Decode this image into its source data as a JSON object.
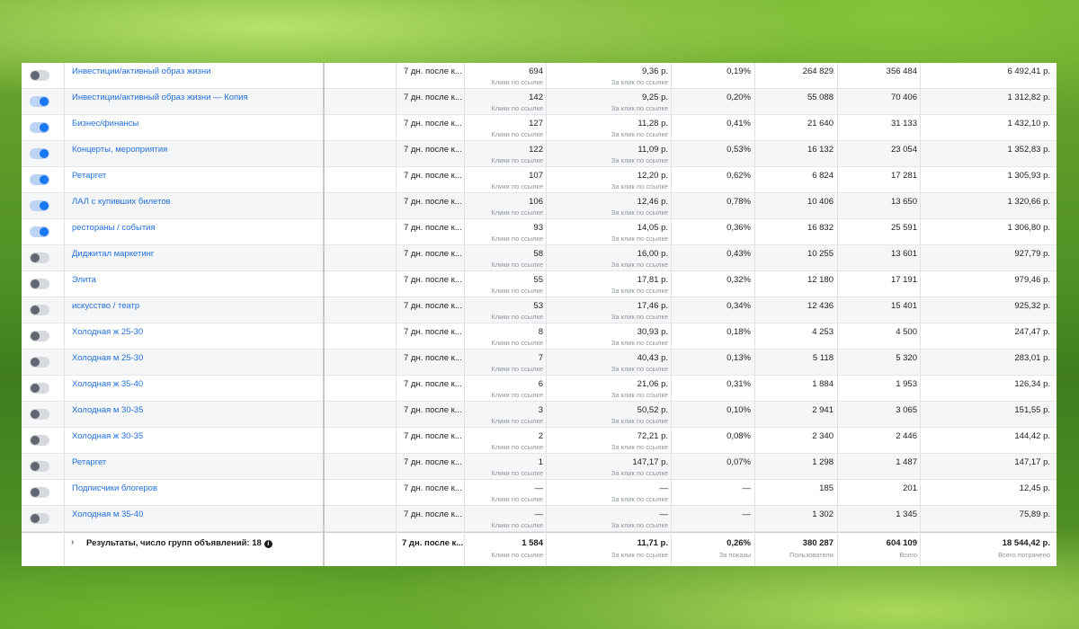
{
  "rows": [
    {
      "on": false,
      "name": "Инвестиции/активный образ жизни",
      "window": "7 дн. после к...",
      "results": "694",
      "results_sub": "Клики по ссылке",
      "cost": "9,36 р.",
      "cost_sub": "За клик по ссылке",
      "ctr": "0,19%",
      "reach": "264 829",
      "impressions": "356 484",
      "spent": "6 492,41 р."
    },
    {
      "on": true,
      "name": "Инвестиции/активный образ жизни — Копия",
      "window": "7 дн. после к...",
      "results": "142",
      "results_sub": "Клики по ссылке",
      "cost": "9,25 р.",
      "cost_sub": "За клик по ссылке",
      "ctr": "0,20%",
      "reach": "55 088",
      "impressions": "70 406",
      "spent": "1 312,82 р."
    },
    {
      "on": true,
      "name": "Бизнес/финансы",
      "window": "7 дн. после к...",
      "results": "127",
      "results_sub": "Клики по ссылке",
      "cost": "11,28 р.",
      "cost_sub": "За клик по ссылке",
      "ctr": "0,41%",
      "reach": "21 640",
      "impressions": "31 133",
      "spent": "1 432,10 р."
    },
    {
      "on": true,
      "name": "Концерты, мероприятия",
      "window": "7 дн. после к...",
      "results": "122",
      "results_sub": "Клики по ссылке",
      "cost": "11,09 р.",
      "cost_sub": "За клик по ссылке",
      "ctr": "0,53%",
      "reach": "16 132",
      "impressions": "23 054",
      "spent": "1 352,83 р."
    },
    {
      "on": true,
      "name": "Ретаргет",
      "window": "7 дн. после к...",
      "results": "107",
      "results_sub": "Клики по ссылке",
      "cost": "12,20 р.",
      "cost_sub": "За клик по ссылке",
      "ctr": "0,62%",
      "reach": "6 824",
      "impressions": "17 281",
      "spent": "1 305,93 р."
    },
    {
      "on": true,
      "name": "ЛАЛ с купивших билетов",
      "window": "7 дн. после к...",
      "results": "106",
      "results_sub": "Клики по ссылке",
      "cost": "12,46 р.",
      "cost_sub": "За клик по ссылке",
      "ctr": "0,78%",
      "reach": "10 406",
      "impressions": "13 650",
      "spent": "1 320,66 р."
    },
    {
      "on": true,
      "name": "рестораны / события",
      "window": "7 дн. после к...",
      "results": "93",
      "results_sub": "Клики по ссылке",
      "cost": "14,05 р.",
      "cost_sub": "За клик по ссылке",
      "ctr": "0,36%",
      "reach": "16 832",
      "impressions": "25 591",
      "spent": "1 306,80 р."
    },
    {
      "on": false,
      "name": "Диджитал маркетинг",
      "window": "7 дн. после к...",
      "results": "58",
      "results_sub": "Клики по ссылке",
      "cost": "16,00 р.",
      "cost_sub": "За клик по ссылке",
      "ctr": "0,43%",
      "reach": "10 255",
      "impressions": "13 601",
      "spent": "927,79 р."
    },
    {
      "on": false,
      "name": "Элита",
      "window": "7 дн. после к...",
      "results": "55",
      "results_sub": "Клики по ссылке",
      "cost": "17,81 р.",
      "cost_sub": "За клик по ссылке",
      "ctr": "0,32%",
      "reach": "12 180",
      "impressions": "17 191",
      "spent": "979,46 р."
    },
    {
      "on": false,
      "name": "искусство / театр",
      "window": "7 дн. после к...",
      "results": "53",
      "results_sub": "Клики по ссылке",
      "cost": "17,46 р.",
      "cost_sub": "За клик по ссылке",
      "ctr": "0,34%",
      "reach": "12 436",
      "impressions": "15 401",
      "spent": "925,32 р."
    },
    {
      "on": false,
      "name": "Холодная ж 25-30",
      "window": "7 дн. после к...",
      "results": "8",
      "results_sub": "Клики по ссылке",
      "cost": "30,93 р.",
      "cost_sub": "За клик по ссылке",
      "ctr": "0,18%",
      "reach": "4 253",
      "impressions": "4 500",
      "spent": "247,47 р."
    },
    {
      "on": false,
      "name": "Холодная м 25-30",
      "window": "7 дн. после к...",
      "results": "7",
      "results_sub": "Клики по ссылке",
      "cost": "40,43 р.",
      "cost_sub": "За клик по ссылке",
      "ctr": "0,13%",
      "reach": "5 118",
      "impressions": "5 320",
      "spent": "283,01 р."
    },
    {
      "on": false,
      "name": "Холодная ж 35-40",
      "window": "7 дн. после к...",
      "results": "6",
      "results_sub": "Клики по ссылке",
      "cost": "21,06 р.",
      "cost_sub": "За клик по ссылке",
      "ctr": "0,31%",
      "reach": "1 884",
      "impressions": "1 953",
      "spent": "126,34 р."
    },
    {
      "on": false,
      "name": "Холодная м 30-35",
      "window": "7 дн. после к...",
      "results": "3",
      "results_sub": "Клики по ссылке",
      "cost": "50,52 р.",
      "cost_sub": "За клик по ссылке",
      "ctr": "0,10%",
      "reach": "2 941",
      "impressions": "3 065",
      "spent": "151,55 р."
    },
    {
      "on": false,
      "name": "Холодная ж 30-35",
      "window": "7 дн. после к...",
      "results": "2",
      "results_sub": "Клики по ссылке",
      "cost": "72,21 р.",
      "cost_sub": "За клик по ссылке",
      "ctr": "0,08%",
      "reach": "2 340",
      "impressions": "2 446",
      "spent": "144,42 р."
    },
    {
      "on": false,
      "name": "Ретаргет",
      "window": "7 дн. после к...",
      "results": "1",
      "results_sub": "Клики по ссылке",
      "cost": "147,17 р.",
      "cost_sub": "За клик по ссылке",
      "ctr": "0,07%",
      "reach": "1 298",
      "impressions": "1 487",
      "spent": "147,17 р."
    },
    {
      "on": false,
      "name": "Подписчики блогеров",
      "window": "7 дн. после к...",
      "results": "—",
      "results_sub": "Клики по ссылке",
      "cost": "—",
      "cost_sub": "За клик по ссылке",
      "ctr": "—",
      "reach": "185",
      "impressions": "201",
      "spent": "12,45 р."
    },
    {
      "on": false,
      "name": "Холодная м 35-40",
      "window": "7 дн. после к...",
      "results": "—",
      "results_sub": "Клики по ссылке",
      "cost": "—",
      "cost_sub": "За клик по ссылке",
      "ctr": "—",
      "reach": "1 302",
      "impressions": "1 345",
      "spent": "75,89 р."
    }
  ],
  "total": {
    "label": "Результаты, число групп объявлений: 18",
    "chevron": "›",
    "info_icon": "i",
    "window": "7 дн. после к...",
    "results": "1 584",
    "results_sub": "Клики по ссылке",
    "cost": "11,71 р.",
    "cost_sub": "За клик по ссылке",
    "ctr": "0,26%",
    "ctr_sub": "За показы",
    "reach": "380 287",
    "reach_sub": "Пользователи",
    "impressions": "604 109",
    "impressions_sub": "Всего",
    "spent": "18 544,42 р.",
    "spent_sub": "Всего потрачено"
  },
  "colors": {
    "toggle_on": "#1877f2",
    "toggle_off": "#606770",
    "link": "#216fdb",
    "muted": "#8d949e"
  }
}
